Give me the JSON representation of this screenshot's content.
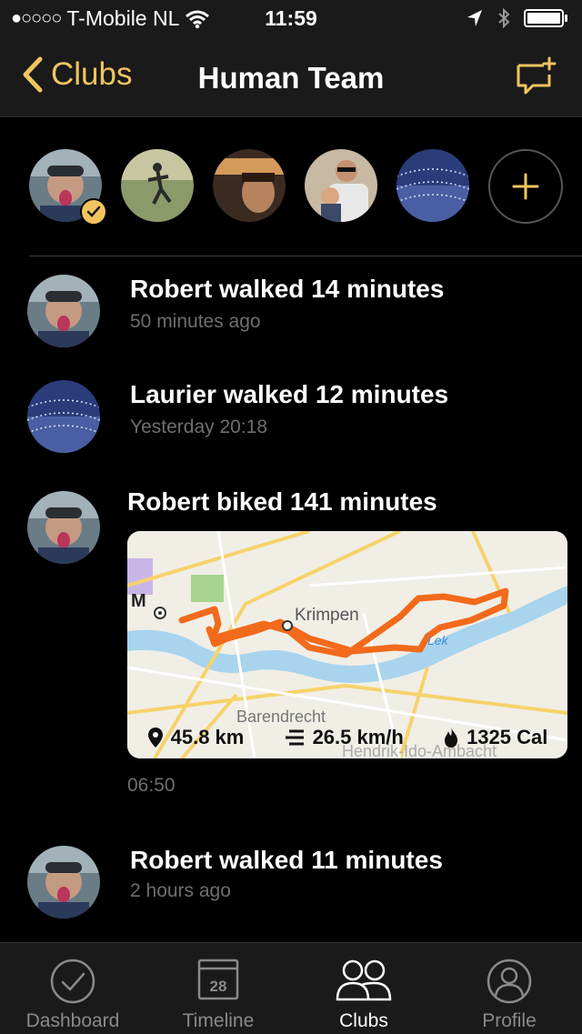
{
  "status_bar": {
    "signal_dots": "●○○○○",
    "carrier": "T-Mobile NL",
    "time": "11:59"
  },
  "nav": {
    "back_label": "Clubs",
    "title": "Human Team"
  },
  "members": [
    {
      "icon": "avatar-robert",
      "verified": true
    },
    {
      "icon": "avatar-member-2"
    },
    {
      "icon": "avatar-member-3"
    },
    {
      "icon": "avatar-member-4"
    },
    {
      "icon": "avatar-laurier"
    }
  ],
  "feed": [
    {
      "title": "Robert walked 14 minutes",
      "time": "50 minutes ago"
    },
    {
      "title": "Laurier walked 12 minutes",
      "time": "Yesterday 20:18"
    },
    {
      "title": "Robert biked 141 minutes",
      "time": "06:50",
      "map": {
        "labels": [
          "M",
          "Krimpen",
          "Barendrecht",
          "Hendrik-Ido-Ambacht",
          "Lek"
        ],
        "distance": "45.8 km",
        "speed": "26.5 km/h",
        "calories": "1325 Cal"
      }
    },
    {
      "title": "Robert walked 11 minutes",
      "time": "2 hours ago"
    }
  ],
  "tabs": [
    {
      "label": "Dashboard",
      "icon": "check-circle-icon"
    },
    {
      "label": "Timeline",
      "icon": "calendar-icon",
      "day": "28"
    },
    {
      "label": "Clubs",
      "icon": "people-icon",
      "active": true
    },
    {
      "label": "Profile",
      "icon": "person-circle-icon"
    }
  ],
  "colors": {
    "accent": "#f2c460",
    "background": "#000000",
    "bar": "#1a1a1a",
    "route": "#f26a1b",
    "secondary_text": "#6e6e6e"
  }
}
